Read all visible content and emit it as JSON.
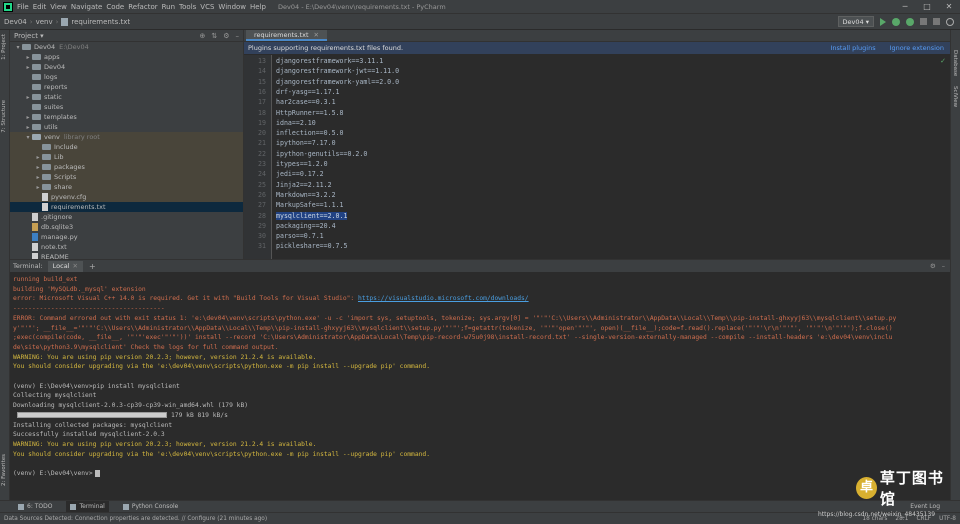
{
  "menubar": {
    "items": [
      "File",
      "Edit",
      "View",
      "Navigate",
      "Code",
      "Refactor",
      "Run",
      "Tools",
      "VCS",
      "Window",
      "Help"
    ],
    "window_title": "Dev04 - E:\\Dev04\\venv\\requirements.txt - PyCharm"
  },
  "navbar": {
    "crumbs": [
      "Dev04",
      "venv",
      "requirements.txt"
    ],
    "run_config": "Dev04 ▾"
  },
  "left_strip": {
    "project_label": "1: Project",
    "structure_label": "7: Structure",
    "favorites_label": "2: Favorites"
  },
  "right_strip": {
    "database_label": "Database",
    "scview_label": "SciView"
  },
  "project": {
    "header": "Project ▾",
    "tree": [
      {
        "indent": 0,
        "arrow": "▾",
        "icon": "folder",
        "label": "Dev04",
        "dim": "E:\\Dev04"
      },
      {
        "indent": 1,
        "arrow": "▸",
        "icon": "folder",
        "label": "apps",
        "dim": ""
      },
      {
        "indent": 1,
        "arrow": "▸",
        "icon": "folder",
        "label": "Dev04",
        "dim": ""
      },
      {
        "indent": 1,
        "arrow": "",
        "icon": "folder",
        "label": "logs",
        "dim": ""
      },
      {
        "indent": 1,
        "arrow": "",
        "icon": "folder",
        "label": "reports",
        "dim": ""
      },
      {
        "indent": 1,
        "arrow": "▸",
        "icon": "folder",
        "label": "static",
        "dim": ""
      },
      {
        "indent": 1,
        "arrow": "",
        "icon": "folder",
        "label": "suites",
        "dim": ""
      },
      {
        "indent": 1,
        "arrow": "▸",
        "icon": "folder",
        "label": "templates",
        "dim": ""
      },
      {
        "indent": 1,
        "arrow": "▸",
        "icon": "folder",
        "label": "utils",
        "dim": ""
      },
      {
        "indent": 1,
        "arrow": "▾",
        "icon": "lib",
        "label": "venv",
        "dim": "library root",
        "zone": true
      },
      {
        "indent": 2,
        "arrow": "",
        "icon": "folder",
        "label": "Include",
        "dim": "",
        "zone": true
      },
      {
        "indent": 2,
        "arrow": "▸",
        "icon": "folder",
        "label": "Lib",
        "dim": "",
        "zone": true
      },
      {
        "indent": 2,
        "arrow": "▸",
        "icon": "folder",
        "label": "packages",
        "dim": "",
        "zone": true
      },
      {
        "indent": 2,
        "arrow": "▸",
        "icon": "folder",
        "label": "Scripts",
        "dim": "",
        "zone": true
      },
      {
        "indent": 2,
        "arrow": "▸",
        "icon": "folder",
        "label": "share",
        "dim": "",
        "zone": true
      },
      {
        "indent": 2,
        "arrow": "",
        "icon": "txt",
        "label": "pyvenv.cfg",
        "dim": "",
        "zone": true
      },
      {
        "indent": 2,
        "arrow": "",
        "icon": "txt",
        "label": "requirements.txt",
        "dim": "",
        "selected": true
      },
      {
        "indent": 1,
        "arrow": "",
        "icon": "txt",
        "label": ".gitignore",
        "dim": ""
      },
      {
        "indent": 1,
        "arrow": "",
        "icon": "db",
        "label": "db.sqlite3",
        "dim": ""
      },
      {
        "indent": 1,
        "arrow": "",
        "icon": "py",
        "label": "manage.py",
        "dim": ""
      },
      {
        "indent": 1,
        "arrow": "",
        "icon": "txt",
        "label": "note.txt",
        "dim": ""
      },
      {
        "indent": 1,
        "arrow": "",
        "icon": "txt",
        "label": "README",
        "dim": ""
      }
    ]
  },
  "editor": {
    "tab_label": "requirements.txt",
    "banner_text": "Plugins supporting requirements.txt files found.",
    "banner_install": "Install plugins",
    "banner_ignore": "Ignore extension",
    "lines": [
      {
        "n": "13",
        "text": "djangorestframework==3.11.1"
      },
      {
        "n": "14",
        "text": "djangorestframework-jwt==1.11.0"
      },
      {
        "n": "15",
        "text": "djangorestframework-yaml==2.0.0"
      },
      {
        "n": "16",
        "text": "drf-yasg==1.17.1"
      },
      {
        "n": "17",
        "text": "har2case==0.3.1"
      },
      {
        "n": "18",
        "text": "HttpRunner==1.5.8"
      },
      {
        "n": "19",
        "text": "idna==2.10"
      },
      {
        "n": "20",
        "text": "inflection==0.5.0"
      },
      {
        "n": "21",
        "text": "ipython==7.17.0"
      },
      {
        "n": "22",
        "text": "ipython-genutils==0.2.0"
      },
      {
        "n": "23",
        "text": "itypes==1.2.0"
      },
      {
        "n": "24",
        "text": "jedi==0.17.2"
      },
      {
        "n": "25",
        "text": "Jinja2==2.11.2"
      },
      {
        "n": "26",
        "text": "Markdown==3.2.2"
      },
      {
        "n": "27",
        "text": "MarkupSafe==1.1.1"
      },
      {
        "n": "28",
        "text": "mysqlclient==2.0.1",
        "highlight": true
      },
      {
        "n": "29",
        "text": "packaging==20.4"
      },
      {
        "n": "30",
        "text": "parso==0.7.1"
      },
      {
        "n": "31",
        "text": "pickleshare==0.7.5"
      }
    ]
  },
  "terminal": {
    "label": "Terminal:",
    "tab": "Local",
    "lines": [
      {
        "cls": "t-err",
        "text": "    running build_ext"
      },
      {
        "cls": "t-err",
        "text": "    building 'MySQLdb._mysql' extension"
      },
      {
        "cls": "t-err",
        "text": "    error: Microsoft Visual C++ 14.0 is required. Get it with \"Build Tools for Visual Studio\": ",
        "link": "https://visualstudio.microsoft.com/downloads/"
      },
      {
        "cls": "t-err",
        "text": "    ----------------------------------------"
      },
      {
        "cls": "t-err",
        "text": "ERROR: Command errored out with exit status 1: 'e:\\dev04\\venv\\scripts\\python.exe' -u -c 'import sys, setuptools, tokenize; sys.argv[0] = '\"'\"'C:\\\\Users\\\\Administrator\\\\AppData\\\\Local\\\\Temp\\\\pip-install-ghxyyj63\\\\mysqlclient\\\\setup.py"
      },
      {
        "cls": "t-err",
        "text": "y'\"'\"'; __file__='\"'\"'C:\\\\Users\\\\Administrator\\\\AppData\\\\Local\\\\Temp\\\\pip-install-ghxyyj63\\\\mysqlclient\\\\setup.py'\"'\"';f=getattr(tokenize, '\"'\"'open'\"'\"', open)(__file__);code=f.read().replace('\"'\"'\\r\\n'\"'\"', '\"'\"'\\n'\"'\"');f.close()"
      },
      {
        "cls": "t-err",
        "text": ";exec(compile(code, __file__, '\"'\"'exec'\"'\"'))' install --record 'C:\\Users\\Administrator\\AppData\\Local\\Temp\\pip-record-w75u0j98\\install-record.txt' --single-version-externally-managed --compile --install-headers 'e:\\dev04\\venv\\inclu"
      },
      {
        "cls": "t-err",
        "text": "de\\site\\python3.9\\mysqlclient' Check the logs for full command output."
      },
      {
        "cls": "t-warn",
        "text": "WARNING: You are using pip version 20.2.3; however, version 21.2.4 is available."
      },
      {
        "cls": "t-warn",
        "text": "You should consider upgrading via the 'e:\\dev04\\venv\\scripts\\python.exe -m pip install --upgrade pip' command."
      },
      {
        "cls": "t-normal",
        "text": ""
      },
      {
        "cls": "t-normal",
        "text": "(venv) E:\\Dev04\\venv>pip install mysqlclient"
      },
      {
        "cls": "t-normal",
        "text": "Collecting mysqlclient"
      },
      {
        "cls": "t-normal",
        "text": "  Downloading mysqlclient-2.0.3-cp39-cp39-win_amd64.whl (179 kB)"
      },
      {
        "cls": "t-prog",
        "text": "     ",
        "progress_after": "179 kB 819 kB/s"
      },
      {
        "cls": "t-normal",
        "text": "Installing collected packages: mysqlclient"
      },
      {
        "cls": "t-normal",
        "text": "Successfully installed mysqlclient-2.0.3"
      },
      {
        "cls": "t-warn",
        "text": "WARNING: You are using pip version 20.2.3; however, version 21.2.4 is available."
      },
      {
        "cls": "t-warn",
        "text": "You should consider upgrading via the 'e:\\dev04\\venv\\scripts\\python.exe -m pip install --upgrade pip' command."
      },
      {
        "cls": "t-normal",
        "text": ""
      },
      {
        "cls": "t-normal",
        "text": "(venv) E:\\Dev04\\venv>"
      }
    ],
    "progress_fraction": 1.0
  },
  "bottom_tabs": {
    "todo": "6: TODO",
    "terminal": "Terminal",
    "python_console": "Python Console",
    "event_log": "Event Log"
  },
  "status": {
    "message": "Data Sources Detected: Connection properties are detected. // Configure (21 minutes ago)",
    "chars": "18 chars",
    "pos": "28:1",
    "crlf": "CRLF",
    "encoding": "UTF-8"
  },
  "watermark": {
    "seal": "卓",
    "text": "草丁图书馆",
    "csdn": "https://blog.csdn.net/weixin_48435139"
  }
}
